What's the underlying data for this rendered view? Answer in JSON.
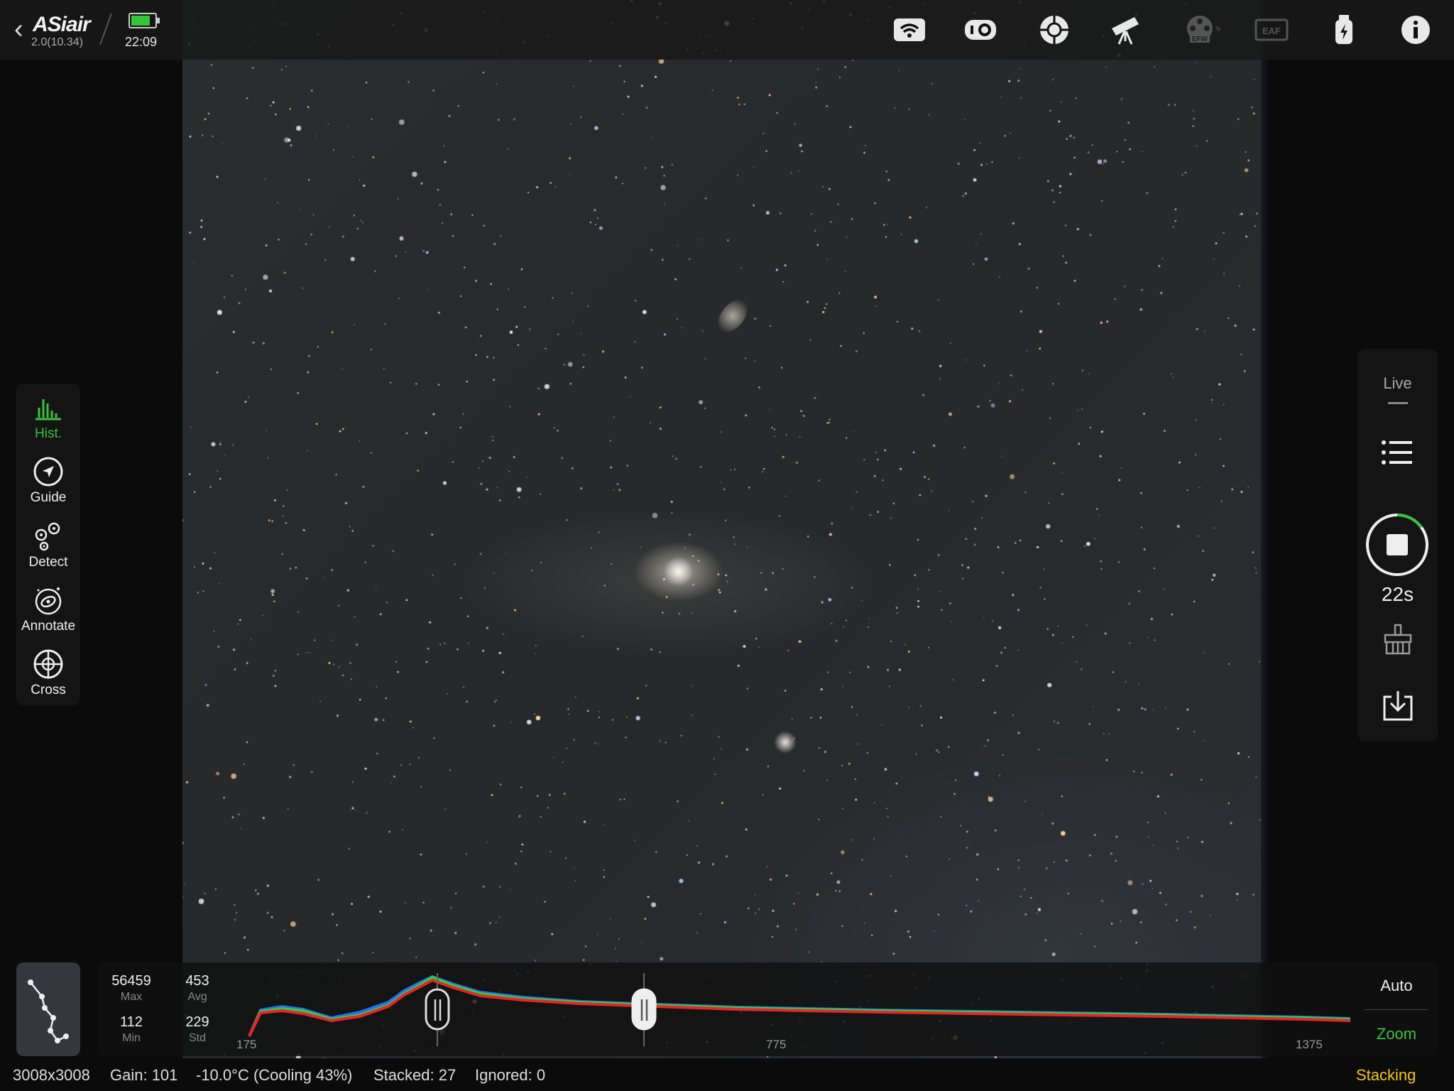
{
  "app": {
    "logo_text": "ASiair",
    "version": "2.0(10.34)",
    "time": "22:09",
    "battery_level": 0.8,
    "back_label": "‹"
  },
  "top_icons": [
    {
      "name": "wifi-icon"
    },
    {
      "name": "camera-icon"
    },
    {
      "name": "guide-scope-icon"
    },
    {
      "name": "telescope-icon"
    },
    {
      "name": "efw-icon",
      "label": "EFW"
    },
    {
      "name": "eaf-icon",
      "label": "EAF"
    },
    {
      "name": "usb-power-icon"
    },
    {
      "name": "info-icon"
    }
  ],
  "tools": [
    {
      "id": "hist",
      "label": "Hist.",
      "icon": "histogram-icon",
      "active": true
    },
    {
      "id": "guide",
      "label": "Guide",
      "icon": "compass-arrow-icon",
      "active": false
    },
    {
      "id": "detect",
      "label": "Detect",
      "icon": "detect-stars-icon",
      "active": false
    },
    {
      "id": "annotate",
      "label": "Annotate",
      "icon": "galaxy-icon",
      "active": false
    },
    {
      "id": "cross",
      "label": "Cross",
      "icon": "crosshair-icon",
      "active": false
    }
  ],
  "capture": {
    "mode_label": "Live",
    "exposure_remaining": "22s",
    "progress": 0.15
  },
  "histogram": {
    "max_value": "56459",
    "max_label": "Max",
    "min_value": "112",
    "min_label": "Min",
    "avg_value": "453",
    "avg_label": "Avg",
    "std_value": "229",
    "std_label": "Std",
    "ticks": [
      "175",
      "775",
      "1375"
    ],
    "auto_label": "Auto",
    "zoom_label": "Zoom",
    "stretch_low": 0.18,
    "stretch_high": 0.37
  },
  "status": {
    "resolution": "3008x3008",
    "gain": "Gain: 101",
    "temperature": "-10.0°C (Cooling 43%)",
    "stacked": "Stacked: 27",
    "ignored": "Ignored: 0",
    "mode": "Stacking"
  },
  "colors": {
    "accent_green": "#38c23f",
    "stacking_yellow": "#f5c317",
    "hist_red": "#e8232a",
    "hist_green": "#2ecc40",
    "hist_blue": "#2b6cf0"
  }
}
